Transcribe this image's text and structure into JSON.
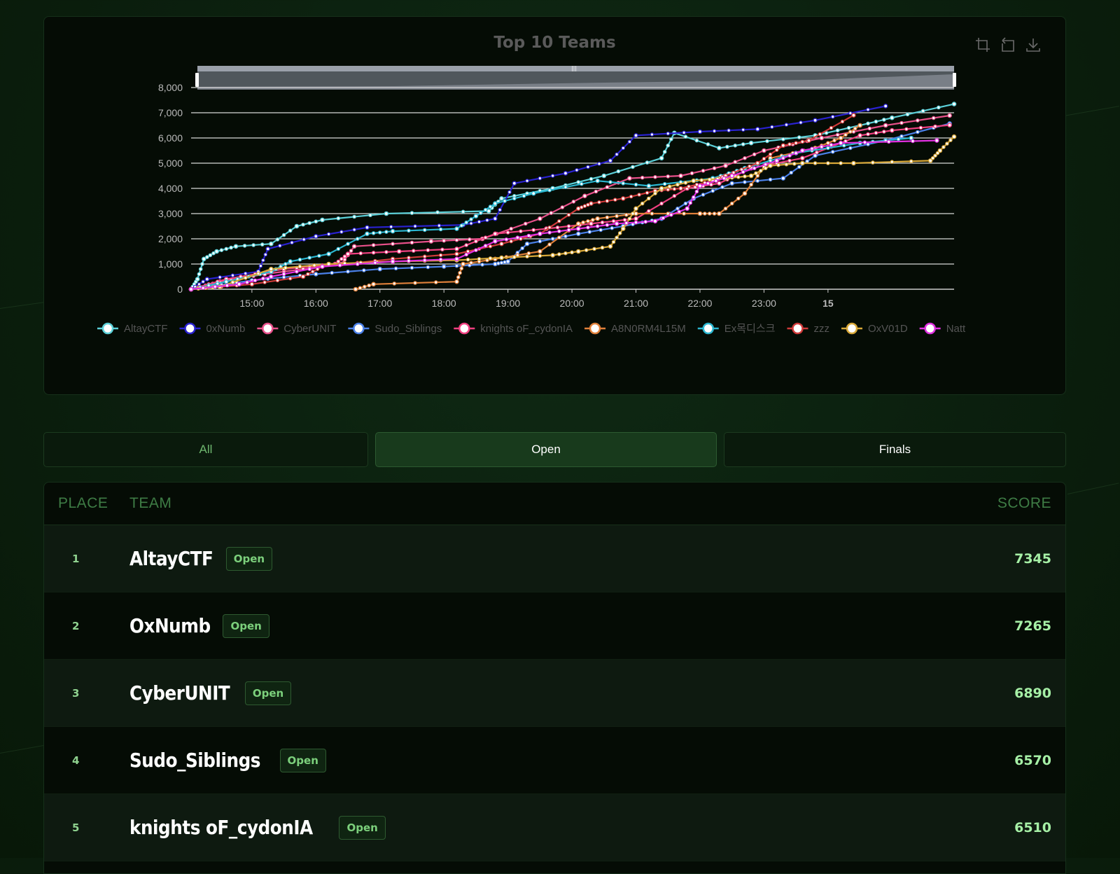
{
  "chart": {
    "title": "Top 10 Teams",
    "toolbox": [
      "zoom-icon",
      "restore-icon",
      "download-icon"
    ]
  },
  "chart_data": {
    "type": "line",
    "title": "Top 10 Teams",
    "xlabel": "",
    "ylabel": "",
    "ylim": [
      0,
      8000
    ],
    "y_ticks": [
      "0",
      "1,000",
      "2,000",
      "3,000",
      "4,000",
      "5,000",
      "6,000",
      "7,000",
      "8,000"
    ],
    "x_ticks": [
      "15:00",
      "16:00",
      "17:00",
      "18:00",
      "19:00",
      "20:00",
      "21:00",
      "22:00",
      "23:00",
      "15"
    ],
    "x_unit": "hours",
    "xlim": [
      14.05,
      25.97
    ],
    "grid": true,
    "legend_position": "bottom",
    "series": [
      {
        "name": "AltayCTF",
        "color": "#5bd0d8",
        "points": [
          [
            14.05,
            0
          ],
          [
            14.15,
            400
          ],
          [
            14.25,
            1200
          ],
          [
            14.45,
            1500
          ],
          [
            14.75,
            1700
          ],
          [
            15.3,
            1800
          ],
          [
            15.7,
            2500
          ],
          [
            16.1,
            2750
          ],
          [
            17.1,
            3000
          ],
          [
            18.7,
            3100
          ],
          [
            18.9,
            3600
          ],
          [
            19.7,
            4000
          ],
          [
            20.5,
            4500
          ],
          [
            21.4,
            5200
          ],
          [
            21.6,
            6200
          ],
          [
            22.3,
            5600
          ],
          [
            22.8,
            5800
          ],
          [
            23.8,
            6100
          ],
          [
            24.5,
            6500
          ],
          [
            25.0,
            6800
          ],
          [
            25.97,
            7345
          ]
        ]
      },
      {
        "name": "0xNumb",
        "color": "#2a22d0",
        "points": [
          [
            14.05,
            0
          ],
          [
            14.3,
            400
          ],
          [
            15.1,
            700
          ],
          [
            15.25,
            1600
          ],
          [
            16.0,
            2100
          ],
          [
            16.8,
            2450
          ],
          [
            18.3,
            2550
          ],
          [
            18.8,
            2800
          ],
          [
            19.1,
            4200
          ],
          [
            19.9,
            4600
          ],
          [
            20.6,
            5100
          ],
          [
            21.0,
            6100
          ],
          [
            22.0,
            6250
          ],
          [
            22.9,
            6350
          ],
          [
            23.8,
            6700
          ],
          [
            24.9,
            7265
          ]
        ]
      },
      {
        "name": "CyberUNIT",
        "color": "#e8508a",
        "points": [
          [
            14.05,
            0
          ],
          [
            14.5,
            300
          ],
          [
            15.2,
            600
          ],
          [
            16.4,
            1000
          ],
          [
            16.6,
            1700
          ],
          [
            17.8,
            1900
          ],
          [
            18.6,
            2000
          ],
          [
            19.5,
            2800
          ],
          [
            20.2,
            3700
          ],
          [
            20.9,
            4400
          ],
          [
            21.7,
            4500
          ],
          [
            22.4,
            4900
          ],
          [
            23.0,
            5500
          ],
          [
            23.9,
            6000
          ],
          [
            24.9,
            6500
          ],
          [
            25.9,
            6890
          ]
        ]
      },
      {
        "name": "Sudo_Siblings",
        "color": "#4a80e8",
        "points": [
          [
            14.05,
            0
          ],
          [
            15.0,
            350
          ],
          [
            16.0,
            600
          ],
          [
            17.0,
            800
          ],
          [
            18.0,
            900
          ],
          [
            18.8,
            1000
          ],
          [
            19.0,
            1100
          ],
          [
            19.3,
            1800
          ],
          [
            20.1,
            2200
          ],
          [
            20.8,
            2500
          ],
          [
            21.4,
            2800
          ],
          [
            21.9,
            3600
          ],
          [
            22.5,
            4200
          ],
          [
            23.3,
            4400
          ],
          [
            23.8,
            5300
          ],
          [
            24.9,
            5900
          ],
          [
            25.9,
            6570
          ]
        ]
      },
      {
        "name": "knights oF_cydonIA",
        "color": "#f04080",
        "points": [
          [
            14.05,
            0
          ],
          [
            14.6,
            400
          ],
          [
            15.5,
            800
          ],
          [
            16.3,
            1000
          ],
          [
            16.5,
            1400
          ],
          [
            17.3,
            1500
          ],
          [
            18.2,
            1600
          ],
          [
            18.8,
            2200
          ],
          [
            19.6,
            2400
          ],
          [
            20.3,
            2600
          ],
          [
            21.0,
            2800
          ],
          [
            21.8,
            4000
          ],
          [
            22.3,
            4200
          ],
          [
            22.8,
            4800
          ],
          [
            23.6,
            5200
          ],
          [
            24.5,
            6100
          ],
          [
            25.0,
            6300
          ],
          [
            25.9,
            6510
          ]
        ]
      },
      {
        "name": "A8N0RM4L15M",
        "color": "#e0803a",
        "points": [
          [
            16.62,
            0
          ],
          [
            16.9,
            200
          ],
          [
            18.2,
            300
          ],
          [
            18.3,
            1000
          ],
          [
            18.8,
            1200
          ],
          [
            19.5,
            1500
          ],
          [
            20.1,
            2600
          ],
          [
            20.4,
            2800
          ],
          [
            21.0,
            3000
          ],
          [
            22.0,
            3000
          ],
          [
            22.3,
            3000
          ],
          [
            22.7,
            3800
          ],
          [
            23.1,
            5200
          ],
          [
            23.8,
            5600
          ],
          [
            24.2,
            6000
          ],
          [
            24.5,
            6500
          ]
        ]
      },
      {
        "name": "Ex목디스크",
        "color": "#2ab6d0",
        "points": [
          [
            14.05,
            0
          ],
          [
            14.6,
            300
          ],
          [
            15.3,
            700
          ],
          [
            15.6,
            1100
          ],
          [
            16.2,
            1400
          ],
          [
            16.8,
            2200
          ],
          [
            17.2,
            2300
          ],
          [
            18.2,
            2400
          ],
          [
            18.5,
            2900
          ],
          [
            18.8,
            3400
          ],
          [
            19.4,
            3800
          ],
          [
            20.4,
            4300
          ],
          [
            21.2,
            4100
          ],
          [
            22.2,
            4400
          ],
          [
            22.7,
            4800
          ],
          [
            23.5,
            5400
          ],
          [
            24.5,
            5800
          ],
          [
            25.3,
            6000
          ]
        ]
      },
      {
        "name": "zzz",
        "color": "#d03a3a",
        "points": [
          [
            14.05,
            0
          ],
          [
            15.0,
            200
          ],
          [
            15.8,
            500
          ],
          [
            16.1,
            900
          ],
          [
            17.2,
            1200
          ],
          [
            18.2,
            1400
          ],
          [
            18.9,
            1800
          ],
          [
            19.5,
            2200
          ],
          [
            20.1,
            3200
          ],
          [
            20.3,
            3400
          ],
          [
            20.8,
            3600
          ],
          [
            21.3,
            3900
          ],
          [
            21.7,
            4000
          ],
          [
            22.2,
            4300
          ],
          [
            22.4,
            4500
          ],
          [
            22.9,
            5000
          ],
          [
            23.3,
            5700
          ],
          [
            23.7,
            5900
          ],
          [
            24.4,
            6900
          ]
        ]
      },
      {
        "name": "OxV01D",
        "color": "#d8a838",
        "points": [
          [
            14.05,
            0
          ],
          [
            14.5,
            100
          ],
          [
            15.3,
            800
          ],
          [
            16.2,
            1000
          ],
          [
            17.2,
            1100
          ],
          [
            18.2,
            1150
          ],
          [
            18.9,
            1250
          ],
          [
            19.7,
            1350
          ],
          [
            20.1,
            1500
          ],
          [
            20.6,
            1700
          ],
          [
            20.8,
            2400
          ],
          [
            21.0,
            3200
          ],
          [
            21.4,
            4000
          ],
          [
            21.9,
            4300
          ],
          [
            22.4,
            4400
          ],
          [
            22.8,
            4500
          ],
          [
            23.1,
            4900
          ],
          [
            23.6,
            5000
          ],
          [
            24.4,
            5000
          ],
          [
            25.6,
            5100
          ],
          [
            25.75,
            5500
          ],
          [
            25.97,
            6050
          ]
        ]
      },
      {
        "name": "Natt",
        "color": "#e030e0",
        "points": [
          [
            14.05,
            0
          ],
          [
            14.8,
            200
          ],
          [
            15.3,
            500
          ],
          [
            16.1,
            900
          ],
          [
            17.2,
            1100
          ],
          [
            18.2,
            1200
          ],
          [
            18.8,
            1900
          ],
          [
            19.5,
            2200
          ],
          [
            20.1,
            2400
          ],
          [
            20.7,
            2600
          ],
          [
            21.3,
            2700
          ],
          [
            21.8,
            3200
          ],
          [
            22.0,
            4100
          ],
          [
            22.5,
            4500
          ],
          [
            23.2,
            5100
          ],
          [
            23.6,
            5500
          ],
          [
            24.2,
            5800
          ],
          [
            25.7,
            5900
          ]
        ]
      }
    ]
  },
  "tabs": [
    {
      "label": "All",
      "state": "plain-green"
    },
    {
      "label": "Open",
      "state": "active"
    },
    {
      "label": "Finals",
      "state": "plain-white"
    }
  ],
  "scoreboard": {
    "headers": {
      "place": "PLACE",
      "team": "TEAM",
      "score": "SCORE"
    },
    "rows": [
      {
        "place": "1",
        "team": "AltayCTF",
        "badge": "Open",
        "score": "7345"
      },
      {
        "place": "2",
        "team": "OxNumb",
        "badge": "Open",
        "score": "7265"
      },
      {
        "place": "3",
        "team": "CyberUNIT",
        "badge": "Open",
        "score": "6890"
      },
      {
        "place": "4",
        "team": "Sudo_Siblings",
        "badge": "Open",
        "score": "6570"
      },
      {
        "place": "5",
        "team": "knights oF_cydonIA",
        "badge": "Open",
        "score": "6510"
      }
    ]
  },
  "colors": {
    "accent": "#7cd07c",
    "background": "#0b1f0e",
    "panel": "#050c05"
  }
}
